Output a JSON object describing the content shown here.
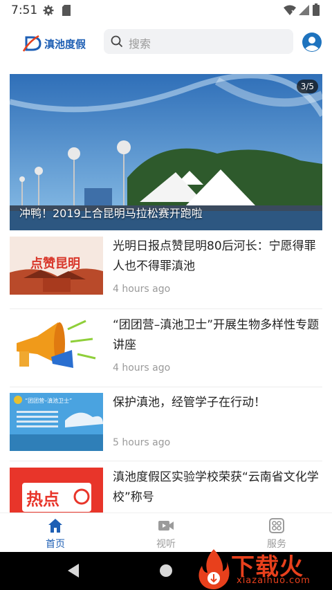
{
  "status_bar": {
    "time": "7:51"
  },
  "header": {
    "logo_text": "滇池度假",
    "search_placeholder": "搜索"
  },
  "banner": {
    "counter": "3/5",
    "caption": "冲鸭！2019上合昆明马拉松赛开跑啦"
  },
  "news": [
    {
      "title": "光明日报点赞昆明80后河长：宁愿得罪人也不得罪滇池",
      "time": "4 hours ago",
      "thumb_text": "点赞昆明"
    },
    {
      "title": "“团团营–滇池卫士”开展生物多样性专题讲座",
      "time": "4 hours ago"
    },
    {
      "title": "保护滇池，经管学子在行动！",
      "time": "5 hours ago",
      "thumb_text": "“团团营–滇池卫士”"
    },
    {
      "title": "滇池度假区实验学校荣获“云南省文化学校”称号",
      "time": "",
      "thumb_text": "热点"
    }
  ],
  "tabs": [
    {
      "label": "首页",
      "icon": "home-icon",
      "active": true
    },
    {
      "label": "视听",
      "icon": "video-icon",
      "active": false
    },
    {
      "label": "服务",
      "icon": "grid-icon",
      "active": false
    }
  ],
  "watermark": {
    "cn": "下载火",
    "en": "xiazaihuo.com"
  },
  "colors": {
    "accent": "#1e5fb4",
    "inactive": "#9b9b9b"
  }
}
